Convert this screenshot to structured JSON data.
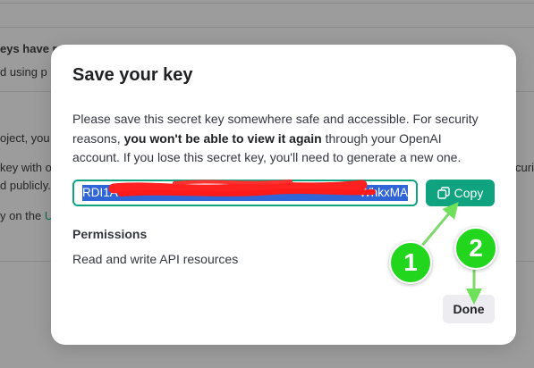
{
  "background": {
    "lines": [
      "eys have re",
      "d using p",
      "oject, you c",
      "key with o",
      "d publicly.",
      "y on the "
    ],
    "link": "U",
    "right_fragment": "ecuri"
  },
  "modal": {
    "title": "Save your key",
    "description_part1": "Please save this secret key somewhere safe and accessible. For security reasons, ",
    "description_bold": "you won't be able to view it again",
    "description_part2": " through your OpenAI account. If you lose this secret key, you'll need to generate a new one.",
    "key_start": "RDI1A-",
    "key_end": "WhkxMA",
    "copy_label": "Copy",
    "permissions_label": "Permissions",
    "permissions_value": "Read and write API resources",
    "done_label": "Done"
  },
  "annotations": {
    "badge1": "1",
    "badge2": "2",
    "color": "#22d61e"
  }
}
